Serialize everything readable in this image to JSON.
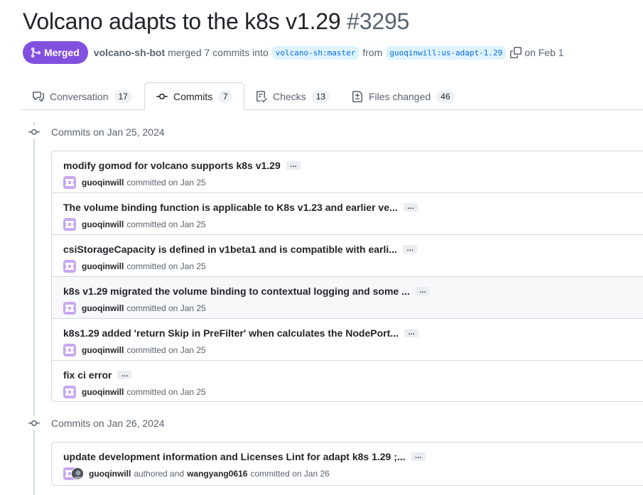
{
  "pr": {
    "title": "Volcano adapts to the k8s v1.29",
    "number": "#3295",
    "status": "Merged",
    "author": "volcano-sh-bot",
    "merged_text": "merged 7 commits into",
    "base_branch": "volcano-sh:master",
    "from_text": "from",
    "head_branch": "guoqinwill:us-adapt-1.29",
    "date_text": "on Feb 1"
  },
  "tabs": [
    {
      "label": "Conversation",
      "count": "17",
      "icon": "comment-discussion-icon"
    },
    {
      "label": "Commits",
      "count": "7",
      "icon": "git-commit-icon"
    },
    {
      "label": "Checks",
      "count": "13",
      "icon": "checklist-icon"
    },
    {
      "label": "Files changed",
      "count": "46",
      "icon": "file-diff-icon"
    }
  ],
  "groups": [
    {
      "date_label": "Commits on Jan 25, 2024",
      "commits": [
        {
          "message": "modify gomod for volcano supports k8s v1.29",
          "author": "guoqinwill",
          "action": "committed on Jan 25"
        },
        {
          "message": "The volume binding function is applicable to K8s v1.23 and earlier ve...",
          "author": "guoqinwill",
          "action": "committed on Jan 25"
        },
        {
          "message": "csiStorageCapacity is defined in v1beta1 and is compatible with earli...",
          "author": "guoqinwill",
          "action": "committed on Jan 25"
        },
        {
          "message": "k8s v1.29 migrated the volume binding to contextual logging and some ...",
          "author": "guoqinwill",
          "action": "committed on Jan 25"
        },
        {
          "message": "k8s1.29 added 'return Skip in PreFilter' when calculates the NodePort...",
          "author": "guoqinwill",
          "action": "committed on Jan 25"
        },
        {
          "message": "fix ci error",
          "author": "guoqinwill",
          "action": "committed on Jan 25"
        }
      ]
    },
    {
      "date_label": "Commits on Jan 26, 2024",
      "commits": [
        {
          "message": "update development information and Licenses Lint for adapt k8s 1.29 ;...",
          "author": "guoqinwill",
          "verb": "authored and",
          "committer": "wangyang0616",
          "action": "committed on Jan 26"
        }
      ]
    }
  ],
  "ellipsis_label": "…",
  "colors": {
    "merged": "#8250df",
    "branch_bg": "#ddf4ff",
    "branch_text": "#0969da",
    "avatar": "#c9a7f0"
  }
}
